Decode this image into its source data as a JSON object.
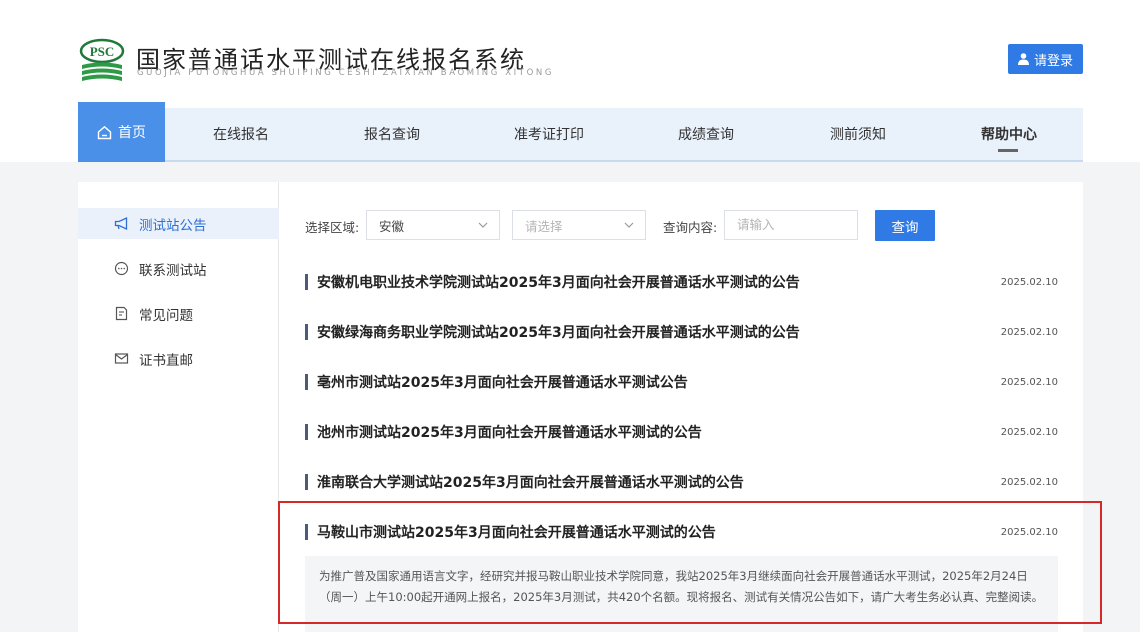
{
  "header": {
    "logo_text": "PSC",
    "title": "国家普通话水平测试在线报名系统",
    "subtitle": "GUOJIA PUTONGHUA SHUIPING CESHI ZAIXIAN BAOMING XITONG",
    "login_label": "请登录"
  },
  "nav": {
    "items": [
      "首页",
      "在线报名",
      "报名查询",
      "准考证打印",
      "成绩查询",
      "测前须知",
      "帮助中心"
    ]
  },
  "sidebar": {
    "items": [
      "测试站公告",
      "联系测试站",
      "常见问题",
      "证书直邮"
    ]
  },
  "filter": {
    "region_label": "选择区域:",
    "region_value": "安徽",
    "city_placeholder": "请选择",
    "content_label": "查询内容:",
    "content_placeholder": "请输入",
    "query_label": "查询"
  },
  "announcements": [
    {
      "title": "安徽机电职业技术学院测试站2025年3月面向社会开展普通话水平测试的公告",
      "date": "2025.02.10"
    },
    {
      "title": "安徽绿海商务职业学院测试站2025年3月面向社会开展普通话水平测试的公告",
      "date": "2025.02.10"
    },
    {
      "title": "亳州市测试站2025年3月面向社会开展普通话水平测试公告",
      "date": "2025.02.10"
    },
    {
      "title": "池州市测试站2025年3月面向社会开展普通话水平测试的公告",
      "date": "2025.02.10"
    },
    {
      "title": "淮南联合大学测试站2025年3月面向社会开展普通话水平测试的公告",
      "date": "2025.02.10"
    },
    {
      "title": "马鞍山市测试站2025年3月面向社会开展普通话水平测试的公告",
      "date": "2025.02.10"
    }
  ],
  "expanded_excerpt": "为推广普及国家通用语言文字，经研究并报马鞍山职业技术学院同意，我站2025年3月继续面向社会开展普通话水平测试，2025年2月24日（周一）上午10:00起开通网上报名，2025年3月测试，共420个名额。现将报名、测试有关情况公告如下，请广大考生务必认真、完整阅读。",
  "colors": {
    "accent": "#2f7ae5",
    "highlight_border": "#d62828",
    "nav_bg": "#e9f1fb"
  }
}
